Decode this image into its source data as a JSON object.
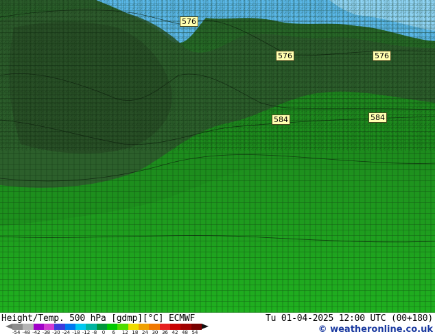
{
  "map": {
    "contour_labels": [
      {
        "id": "c1",
        "text": "576"
      },
      {
        "id": "c2",
        "text": "576"
      },
      {
        "id": "c3",
        "text": "576"
      },
      {
        "id": "c4",
        "text": "584"
      },
      {
        "id": "c5",
        "text": "584"
      }
    ],
    "colors": {
      "dark_green": "#2f5a2a",
      "mid_green": "#1f8a1f",
      "bright_green": "#19b019",
      "cold_blue": "#5ab8e8",
      "light_blue": "#7ccbf0"
    }
  },
  "footer": {
    "title": "Height/Temp. 500 hPa [gdmp][°C] ECMWF",
    "time": "Tu 01-04-2025 12:00 UTC (00+180)",
    "credit": "© weatheronline.co.uk"
  },
  "legend": {
    "colors": [
      "#8c8c8c",
      "#b4b4b4",
      "#a000c8",
      "#d23cd2",
      "#3c3cdc",
      "#0078f0",
      "#00c8f0",
      "#00b4a0",
      "#00963c",
      "#00c800",
      "#50dc00",
      "#f0dc00",
      "#f0a000",
      "#f07800",
      "#e61e1e",
      "#c80000",
      "#a00000",
      "#780000"
    ],
    "ticks": [
      "-54",
      "-48",
      "-42",
      "-38",
      "-30",
      "-24",
      "-18",
      "-12",
      "-8",
      "0",
      "6",
      "12",
      "18",
      "24",
      "30",
      "36",
      "42",
      "48",
      "54"
    ]
  }
}
